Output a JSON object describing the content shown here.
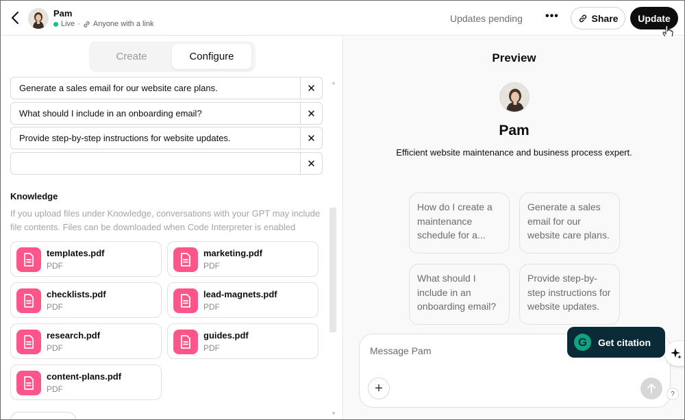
{
  "header": {
    "back_icon": "chevron-left-icon",
    "name": "Pam",
    "status": "Live",
    "separator": "·",
    "visibility": "Anyone with a link",
    "pending": "Updates pending",
    "more": "•••",
    "share_label": "Share",
    "update_label": "Update"
  },
  "tabs": {
    "create": "Create",
    "configure": "Configure"
  },
  "starters": [
    "Generate a sales email for our website care plans.",
    "What should I include in an onboarding email?",
    "Provide step-by-step instructions for website updates.",
    ""
  ],
  "remove_glyph": "✕",
  "knowledge": {
    "title": "Knowledge",
    "description": "If you upload files under Knowledge, conversations with your GPT may include file contents. Files can be downloaded when Code Interpreter is enabled",
    "files": [
      {
        "name": "templates.pdf",
        "type": "PDF"
      },
      {
        "name": "marketing.pdf",
        "type": "PDF"
      },
      {
        "name": "checklists.pdf",
        "type": "PDF"
      },
      {
        "name": "lead-magnets.pdf",
        "type": "PDF"
      },
      {
        "name": "research.pdf",
        "type": "PDF"
      },
      {
        "name": "guides.pdf",
        "type": "PDF"
      },
      {
        "name": "content-plans.pdf",
        "type": "PDF"
      }
    ]
  },
  "preview": {
    "title": "Preview",
    "name": "Pam",
    "description": "Efficient website maintenance and business process expert.",
    "suggestions": [
      "How do I create a maintenance schedule for a...",
      "Generate a sales email for our website care plans.",
      "What should I include in an onboarding email?",
      "Provide step-by-step instructions for website updates."
    ],
    "composer_placeholder": "Message Pam",
    "plus": "+"
  },
  "extension": {
    "label": "Get citation",
    "logo": "G",
    "help": "?"
  },
  "colors": {
    "accent": "#0d0d0d",
    "file_icon": "#ff5588",
    "live": "#19c37d",
    "citation_bg": "#0b2a37"
  }
}
